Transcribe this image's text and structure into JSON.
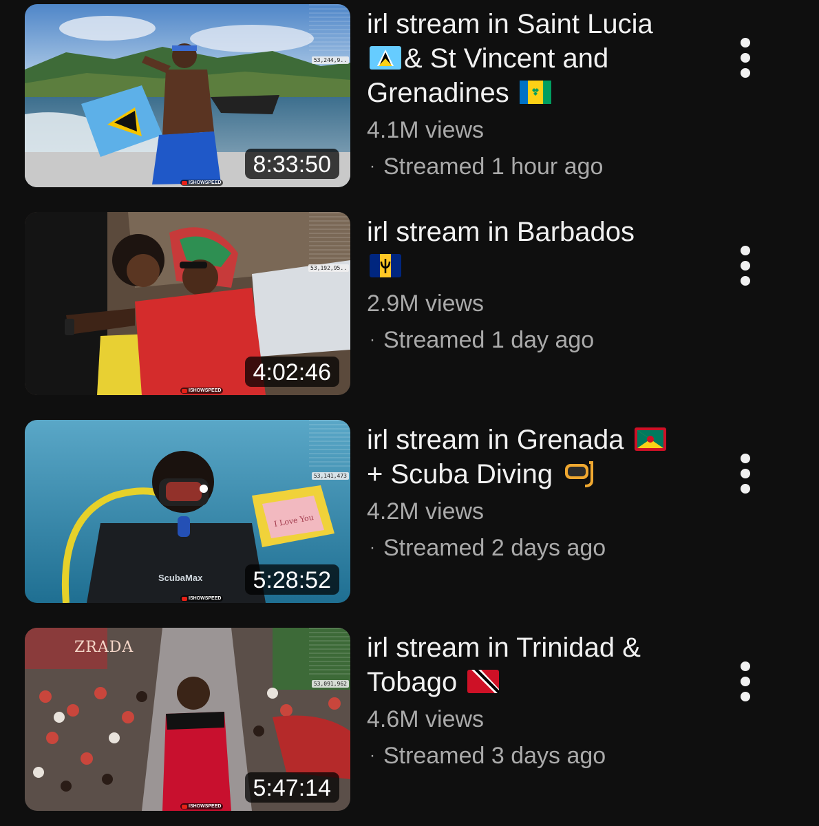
{
  "videos": [
    {
      "title_parts": [
        "irl stream in Saint Lucia",
        "& St Vincent and Grenadines"
      ],
      "flags": [
        "saint-lucia-flag-icon",
        "st-vincent-flag-icon"
      ],
      "views": "4.1M views",
      "streamed": "Streamed 1 hour ago",
      "duration": "8:33:50",
      "viewer_count": "53,244,9..",
      "channel_badge": "ISHOWSPEED"
    },
    {
      "title_parts": [
        "irl stream in Barbados"
      ],
      "flags": [
        "barbados-flag-icon"
      ],
      "views": "2.9M views",
      "streamed": "Streamed 1 day ago",
      "duration": "4:02:46",
      "viewer_count": "53,192,95..",
      "channel_badge": "ISHOWSPEED"
    },
    {
      "title_parts": [
        "irl stream in Grenada",
        "+ Scuba Diving"
      ],
      "flags": [
        "grenada-flag-icon",
        "diving-mask-icon"
      ],
      "views": "4.2M views",
      "streamed": "Streamed 2 days ago",
      "duration": "5:28:52",
      "viewer_count": "53,141,473",
      "channel_badge": "ISHOWSPEED",
      "thumb_text": [
        "ScubaMax",
        "I Love You"
      ]
    },
    {
      "title_parts": [
        "irl stream in Trinidad &",
        "Tobago"
      ],
      "flags": [
        "trinidad-tobago-flag-icon"
      ],
      "views": "4.6M views",
      "streamed": "Streamed 3 days ago",
      "duration": "5:47:14",
      "viewer_count": "53,091,962",
      "channel_badge": "ISHOWSPEED",
      "thumb_text": [
        "ZRADA"
      ]
    }
  ],
  "colors": {
    "background": "#0f0f0f",
    "title": "#f1f1f1",
    "secondary_text": "#aaaaaa"
  }
}
